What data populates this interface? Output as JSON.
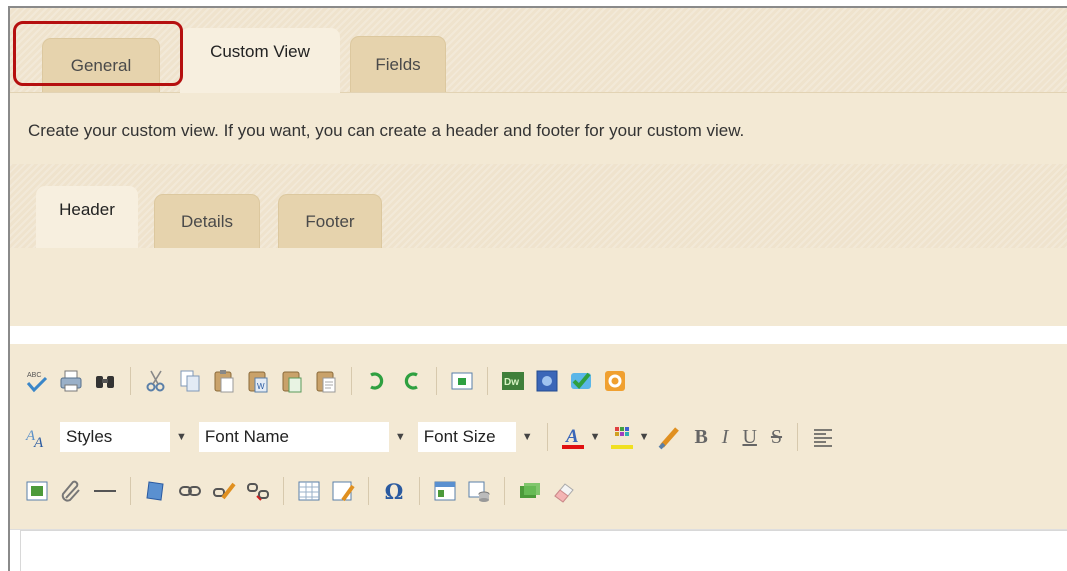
{
  "main_tabs": [
    "General",
    "Custom View",
    "Fields"
  ],
  "description": "Create your custom view. If you want, you can create a header and footer for your custom view.",
  "sub_tabs": [
    "Header",
    "Details",
    "Footer"
  ],
  "toolbar": {
    "styles_label": "Styles",
    "font_name_label": "Font Name",
    "font_size_label": "Font Size",
    "bold": "B",
    "italic": "I",
    "underline": "U",
    "strike": "S",
    "omega": "Ω",
    "dw": "Dw"
  },
  "colors": {
    "highlight_border": "#b50f0f",
    "panel": "#f3e9d4",
    "tab_inactive": "#e6d3ad"
  }
}
